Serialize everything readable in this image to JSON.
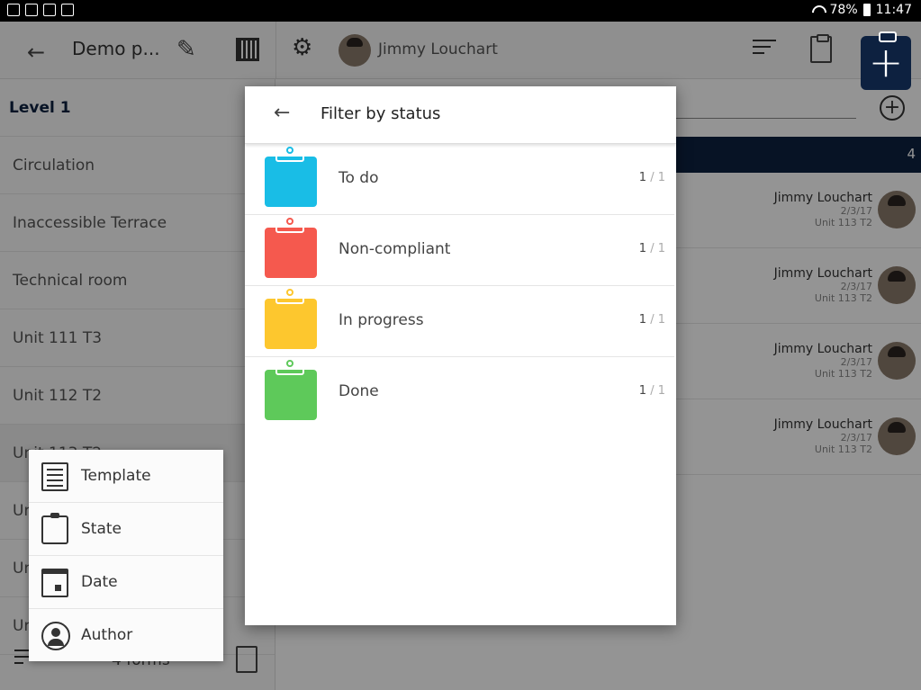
{
  "status_bar": {
    "battery": "78%",
    "time": "11:47"
  },
  "toolbar": {
    "back_icon": "arrow-back-icon",
    "project_title": "Demo p...",
    "edit_icon": "pencil-icon",
    "qr_icon": "qr-code-icon",
    "settings_icon": "gear-icon",
    "user_name": "Jimmy Louchart",
    "sort_icon": "sort-icon",
    "forms_icon": "clipboard-icon",
    "add_icon": "plus-icon"
  },
  "left_panel": {
    "level": "Level 1",
    "items": [
      {
        "label": "Circulation"
      },
      {
        "label": "Inaccessible Terrace"
      },
      {
        "label": "Technical room"
      },
      {
        "label": "Unit 111 T3"
      },
      {
        "label": "Unit 112 T2"
      },
      {
        "label": "Unit 113 T2"
      },
      {
        "label": "Unit 114 T3"
      },
      {
        "label": "Unit 115 T2"
      },
      {
        "label": "Unit 116 T3"
      }
    ],
    "footer_count": "4 forms"
  },
  "right_panel": {
    "group_count": "4",
    "cards": [
      {
        "name": "Jimmy Louchart",
        "date": "2/3/17",
        "unit": "Unit 113 T2"
      },
      {
        "name": "Jimmy Louchart",
        "date": "2/3/17",
        "unit": "Unit 113 T2"
      },
      {
        "name": "Jimmy Louchart",
        "date": "2/3/17",
        "unit": "Unit 113 T2"
      },
      {
        "name": "Jimmy Louchart",
        "date": "2/3/17",
        "unit": "Unit 113 T2"
      }
    ]
  },
  "filter_menu": {
    "items": [
      {
        "label": "Template",
        "icon": "template-icon"
      },
      {
        "label": "State",
        "icon": "clipboard-icon"
      },
      {
        "label": "Date",
        "icon": "calendar-icon"
      },
      {
        "label": "Author",
        "icon": "person-icon"
      }
    ]
  },
  "dialog": {
    "title": "Filter by status",
    "statuses": [
      {
        "label": "To do",
        "count": "1",
        "total": "1",
        "color": "#19bde6"
      },
      {
        "label": "Non-compliant",
        "count": "1",
        "total": "1",
        "color": "#f5594e"
      },
      {
        "label": "In progress",
        "count": "1",
        "total": "1",
        "color": "#fdc72e"
      },
      {
        "label": "Done",
        "count": "1",
        "total": "1",
        "color": "#5ec95a"
      }
    ]
  },
  "colors": {
    "brand_navy": "#0d2140"
  }
}
